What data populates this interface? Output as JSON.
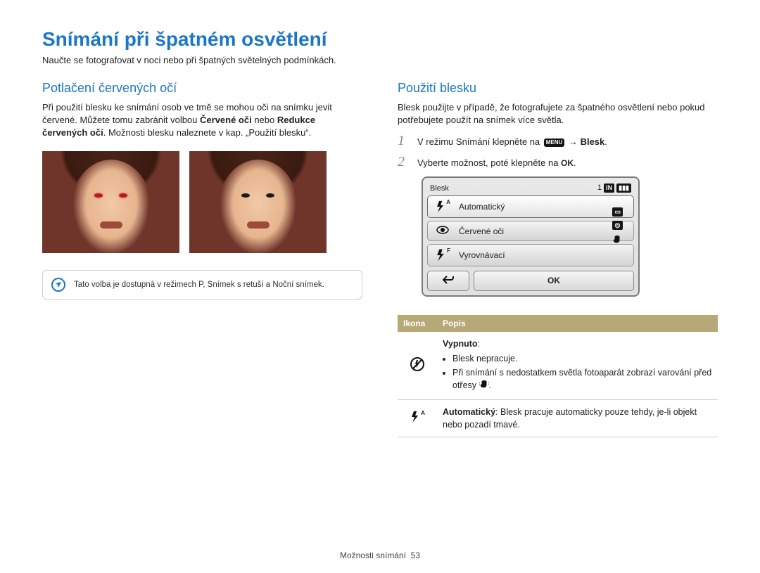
{
  "title": "Snímání při špatném osvětlení",
  "subtitle": "Naučte se fotografovat v noci nebo při špatných světelných podmínkách.",
  "left": {
    "heading": "Potlačení červených očí",
    "para_pre": "Při použití blesku ke snímání osob ve tmě se mohou oči na snímku jevit červené. Můžete tomu zabránit volbou ",
    "bold1": "Červené oči",
    "para_mid": " nebo ",
    "bold2": "Redukce červených očí",
    "para_post": ". Možnosti blesku naleznete v kap. „Použití blesku“.",
    "note": "Tato volba je dostupná v režimech P, Snímek s retuší a Noční snímek."
  },
  "right": {
    "heading": "Použití blesku",
    "intro": "Blesk použijte v případě, že fotografujete za špatného osvětlení nebo pokud potřebujete použít na snímek více světla.",
    "step1_pre": "V režimu Snímání klepněte na ",
    "step1_menu": "MENU",
    "step1_arrow": "→",
    "step1_bold": "Blesk",
    "step1_end": ".",
    "step2_pre": "Vyberte možnost, poté klepněte na ",
    "step2_ok": "OK",
    "step2_end": ".",
    "screen": {
      "title": "Blesk",
      "counter": "1",
      "options": [
        "Automatický",
        "Červené oči",
        "Vyrovnávací"
      ],
      "ok": "OK"
    },
    "table": {
      "h1": "Ikona",
      "h2": "Popis",
      "row1_title": "Vypnuto",
      "row1_b1": "Blesk nepracuje.",
      "row1_b2_pre": "Při snímání s nedostatkem světla fotoaparát zobrazí varování před otřesy ",
      "row1_b2_post": ".",
      "row2_bold": "Automatický",
      "row2_text": ": Blesk pracuje automaticky pouze tehdy, je-li objekt nebo pozadí tmavé."
    }
  },
  "footer_label": "Možnosti snímání",
  "footer_page": "53"
}
